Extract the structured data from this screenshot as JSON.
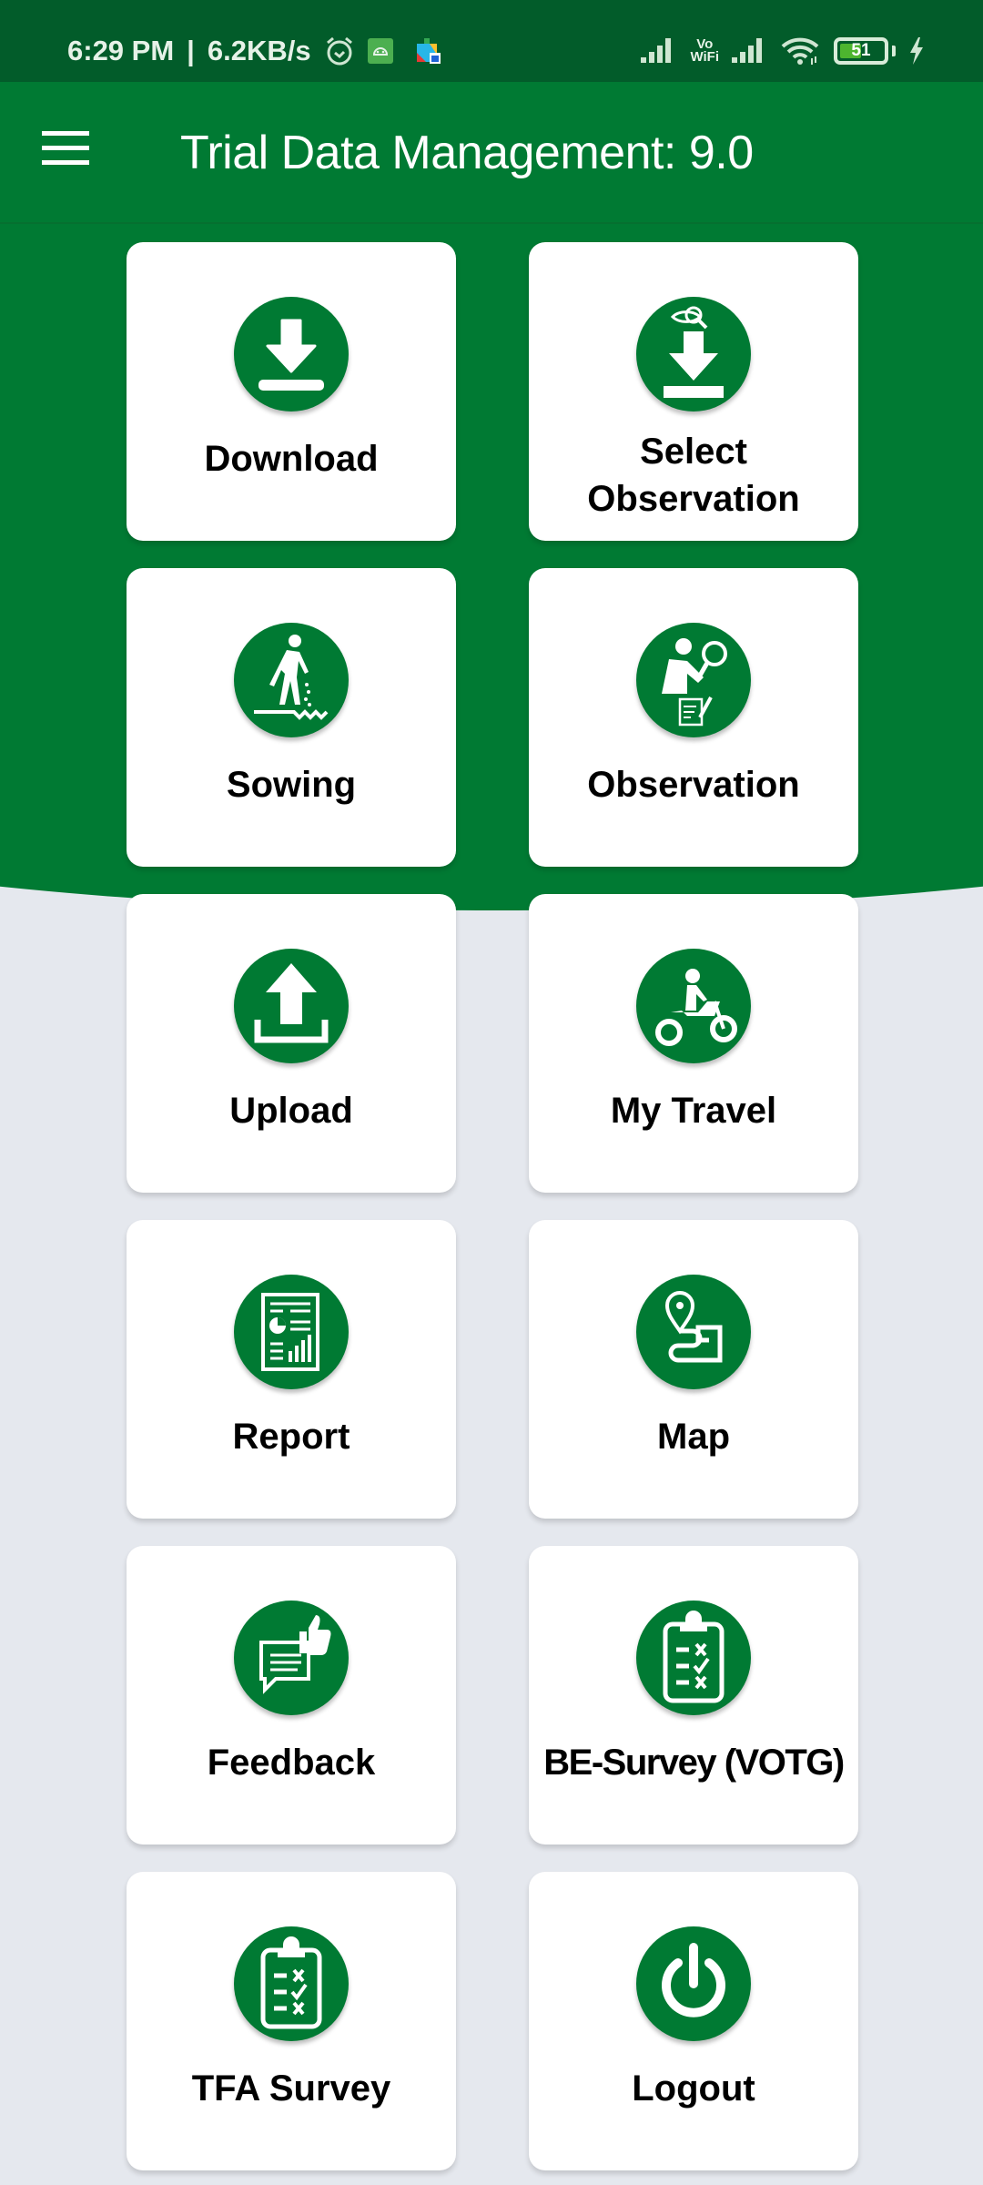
{
  "status_bar": {
    "time": "6:29 PM",
    "network_speed": "6.2KB/s",
    "separator": "|",
    "icons_left": [
      "alarm-icon",
      "android-app-icon",
      "play-services-icon"
    ],
    "icons_right": [
      "signal-icon",
      "vowifi-icon",
      "signal-icon",
      "wifi-icon",
      "battery-icon",
      "charging-icon"
    ],
    "vowifi_top": "Vo",
    "vowifi_bottom": "WiFi",
    "battery_level": "51",
    "battery_percent": 51
  },
  "app_bar": {
    "title": "Trial Data Management: 9.0",
    "menu_icon": "hamburger-menu-icon"
  },
  "colors": {
    "primary": "#007a33",
    "status_bar": "#025c2a",
    "background": "#e5e8ee",
    "tile": "#ffffff",
    "label": "#000000"
  },
  "tiles": [
    {
      "label": "Download",
      "icon": "download-icon"
    },
    {
      "label": "Select Observation",
      "line1": "Select",
      "line2": "Observation",
      "icon": "select-observation-icon"
    },
    {
      "label": "Sowing",
      "icon": "sowing-icon"
    },
    {
      "label": "Observation",
      "icon": "observation-icon"
    },
    {
      "label": "Upload",
      "icon": "upload-icon"
    },
    {
      "label": "My Travel",
      "icon": "motorcycle-icon"
    },
    {
      "label": "Report",
      "icon": "report-icon"
    },
    {
      "label": "Map",
      "icon": "map-route-icon"
    },
    {
      "label": "Feedback",
      "icon": "feedback-icon"
    },
    {
      "label": "BE-Survey (VOTG)",
      "icon": "clipboard-checklist-icon"
    },
    {
      "label": "TFA Survey",
      "icon": "clipboard-checklist-icon"
    },
    {
      "label": "Logout",
      "icon": "power-icon"
    }
  ]
}
